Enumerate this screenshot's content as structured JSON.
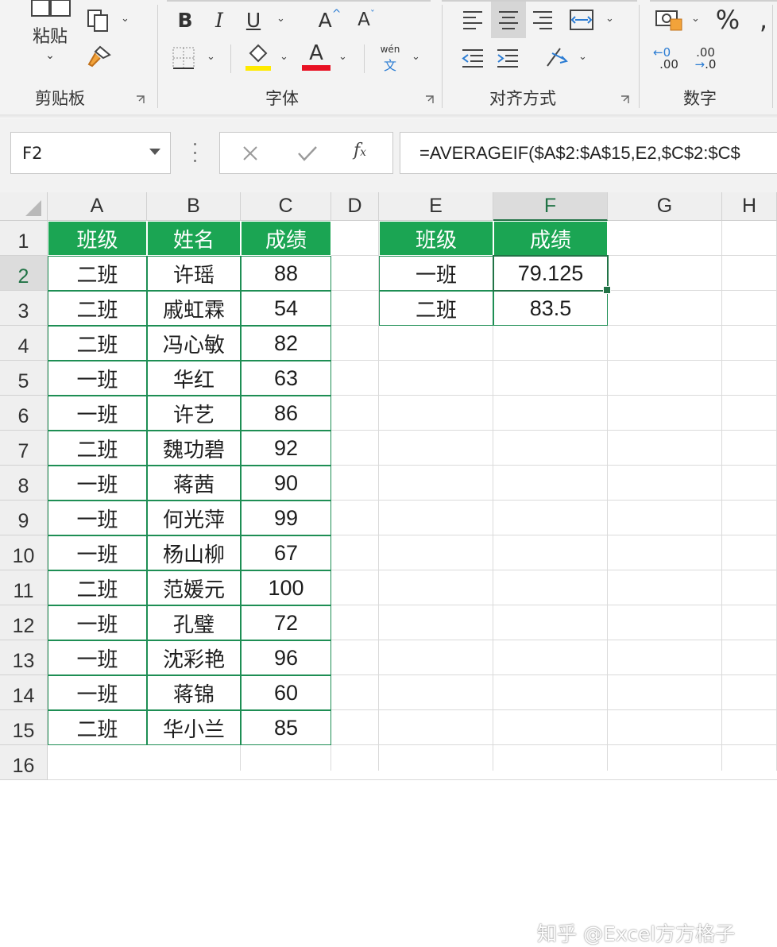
{
  "ribbon": {
    "clipboard": {
      "paste_label": "粘贴",
      "group_label": "剪贴板"
    },
    "font": {
      "group_label": "字体",
      "bold": "B",
      "italic": "I",
      "underline": "U",
      "grow_font": "A",
      "shrink_font": "A",
      "font_color_letter": "A",
      "highlight_color": "#ffea00",
      "font_color": "#e81123",
      "phonetic_top": "wén",
      "phonetic_bottom": "文"
    },
    "alignment": {
      "group_label": "对齐方式"
    },
    "number": {
      "group_label": "数字",
      "percent": "%",
      "comma": ",",
      "inc_decimal": ".00",
      "dec_decimal": ".0"
    }
  },
  "formula_bar": {
    "name_box": "F2",
    "formula": "=AVERAGEIF($A$2:$A$15,E2,$C$2:$C$"
  },
  "sheet": {
    "columns": [
      "A",
      "B",
      "C",
      "D",
      "E",
      "F",
      "G",
      "H"
    ],
    "rows": [
      "1",
      "2",
      "3",
      "4",
      "5",
      "6",
      "7",
      "8",
      "9",
      "10",
      "11",
      "12",
      "13",
      "14",
      "15",
      "16"
    ],
    "selected_cell": "F2",
    "table1": {
      "headers": [
        "班级",
        "姓名",
        "成绩"
      ],
      "rows": [
        [
          "二班",
          "许瑶",
          "88"
        ],
        [
          "二班",
          "戚虹霖",
          "54"
        ],
        [
          "二班",
          "冯心敏",
          "82"
        ],
        [
          "一班",
          "华红",
          "63"
        ],
        [
          "一班",
          "许艺",
          "86"
        ],
        [
          "二班",
          "魏功碧",
          "92"
        ],
        [
          "一班",
          "蒋茜",
          "90"
        ],
        [
          "一班",
          "何光萍",
          "99"
        ],
        [
          "一班",
          "杨山柳",
          "67"
        ],
        [
          "二班",
          "范媛元",
          "100"
        ],
        [
          "一班",
          "孔璧",
          "72"
        ],
        [
          "一班",
          "沈彩艳",
          "96"
        ],
        [
          "一班",
          "蒋锦",
          "60"
        ],
        [
          "二班",
          "华小兰",
          "85"
        ]
      ]
    },
    "table2": {
      "headers": [
        "班级",
        "成绩"
      ],
      "rows": [
        [
          "一班",
          "79.125"
        ],
        [
          "二班",
          "83.5"
        ]
      ]
    },
    "header_fill": "#1ba553",
    "border_color": "#1e8e54"
  },
  "watermark": "知乎 @Excel方方格子"
}
